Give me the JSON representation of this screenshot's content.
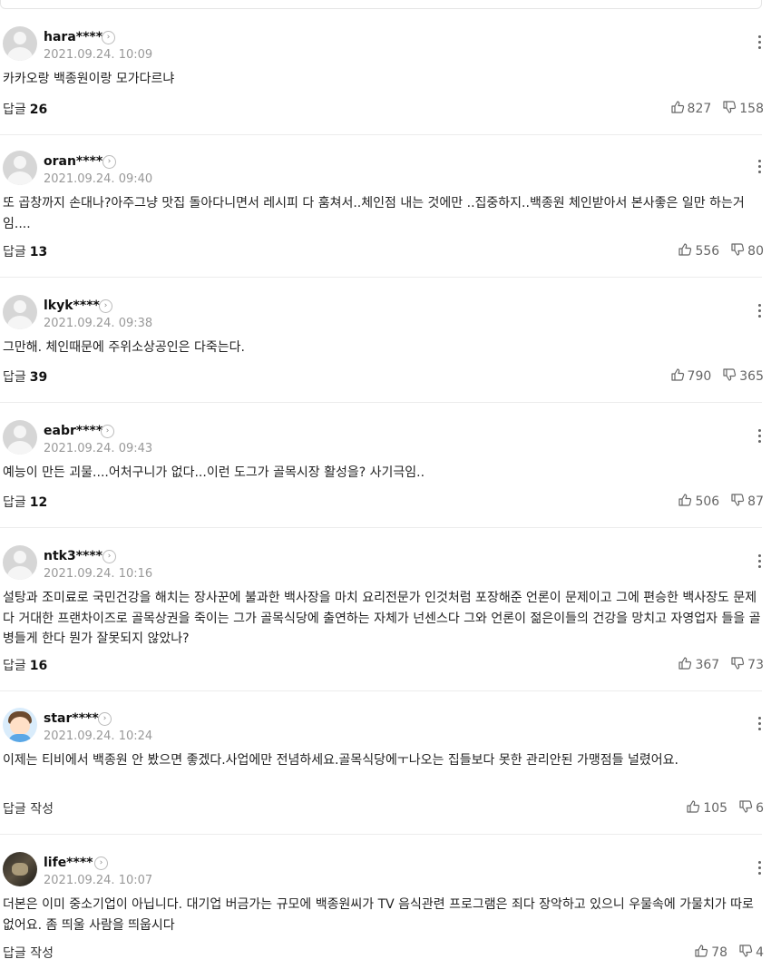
{
  "comments": [
    {
      "user": "hara****",
      "date": "2021.09.24. 10:09",
      "text": "카카오랑 백종원이랑 모가다르냐",
      "reply_label": "답글",
      "reply_count": "26",
      "likes": "827",
      "dislikes": "158",
      "avatar": "default"
    },
    {
      "user": "oran****",
      "date": "2021.09.24. 09:40",
      "text": "또 곱창까지 손대나?아주그냥 맛집 돌아다니면서 레시피 다 훔쳐서..체인점 내는 것에만 ..집중하지..백종원 체인받아서 본사좋은 일만 하는거임....",
      "reply_label": "답글",
      "reply_count": "13",
      "likes": "556",
      "dislikes": "80",
      "avatar": "default"
    },
    {
      "user": "lkyk****",
      "date": "2021.09.24. 09:38",
      "text": "그만해. 체인때문에 주위소상공인은 다죽는다.",
      "reply_label": "답글",
      "reply_count": "39",
      "likes": "790",
      "dislikes": "365",
      "avatar": "default"
    },
    {
      "user": "eabr****",
      "date": "2021.09.24. 09:43",
      "text": "예능이 만든 괴물....어처구니가 없다...이런 도그가 골목시장 활성을? 사기극임..",
      "reply_label": "답글",
      "reply_count": "12",
      "likes": "506",
      "dislikes": "87",
      "avatar": "default"
    },
    {
      "user": "ntk3****",
      "date": "2021.09.24. 10:16",
      "text": "설탕과 조미료로 국민건강을 해치는 장사꾼에 불과한 백사장을 마치 요리전문가 인것처럼 포장해준 언론이 문제이고 그에 편승한 백사장도 문제다 거대한 프랜차이즈로 골목상권을 죽이는 그가 골목식당에 출연하는 자체가 넌센스다 그와 언론이 젊은이들의 건강을 망치고 자영업자 들을 골병들게 한다 뭔가 잘못되지 않았나?",
      "reply_label": "답글",
      "reply_count": "16",
      "likes": "367",
      "dislikes": "73",
      "avatar": "default"
    },
    {
      "user": "star****",
      "date": "2021.09.24. 10:24",
      "text": "이제는 티비에서 백종원 안 봤으면 좋겠다.사업에만 전념하세요.골목식당에ㅜ나오는 집들보다 못한 관리안된 가맹점들 널렸어요.",
      "reply_label": "답글 작성",
      "reply_count": "",
      "likes": "105",
      "dislikes": "6",
      "avatar": "cartoon"
    },
    {
      "user": "life****",
      "date": "2021.09.24. 10:07",
      "text": "더본은 이미 중소기업이 아닙니다. 대기업 버금가는 규모에 백종원씨가 TV 음식관련 프로그램은 죄다 장악하고 있으니 우물속에 가물치가 따로 없어요. 좀 띄울 사람을 띄웁시다",
      "reply_label": "답글 작성",
      "reply_count": "",
      "likes": "78",
      "dislikes": "4",
      "avatar": "photo"
    }
  ]
}
